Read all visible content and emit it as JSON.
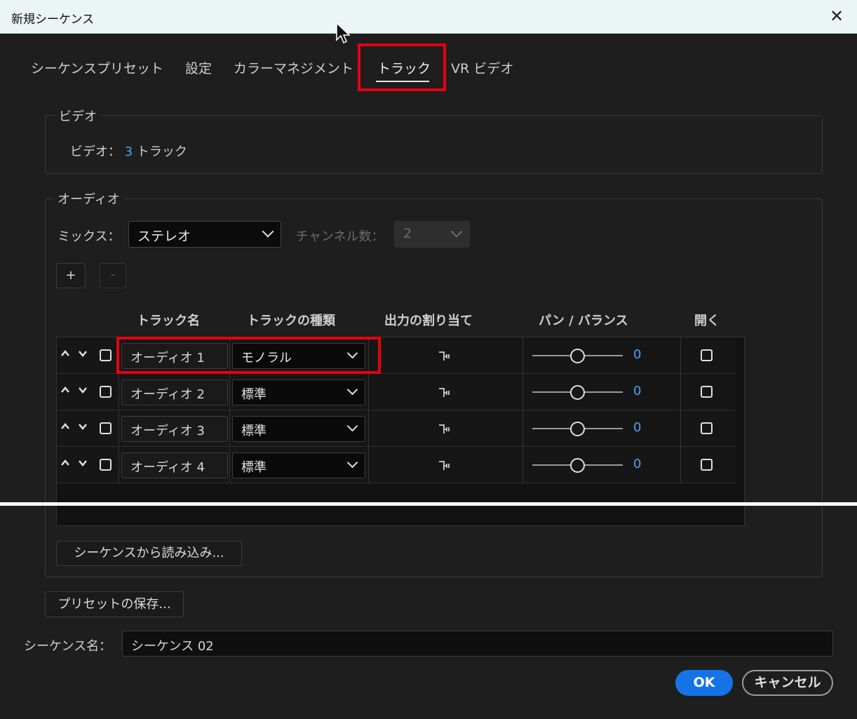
{
  "window": {
    "title": "新規シーケンス"
  },
  "tabs": [
    {
      "label": "シーケンスプリセット"
    },
    {
      "label": "設定"
    },
    {
      "label": "カラーマネジメント"
    },
    {
      "label": "トラック"
    },
    {
      "label": "VR ビデオ"
    }
  ],
  "video": {
    "legend": "ビデオ",
    "label": "ビデオ：",
    "count": "3",
    "unit": "トラック"
  },
  "audio": {
    "legend": "オーディオ",
    "mix_label": "ミックス：",
    "mix_value": "ステレオ",
    "channels_label": "チャンネル数：",
    "channels_value": "2",
    "add_label": "+",
    "remove_label": "-",
    "columns": {
      "name": "トラック名",
      "type": "トラックの種類",
      "output": "出力の割り当て",
      "pan": "パン / バランス",
      "open": "開く"
    },
    "tracks": [
      {
        "name": "オーディオ 1",
        "type": "モノラル",
        "pan": "0"
      },
      {
        "name": "オーディオ 2",
        "type": "標準",
        "pan": "0"
      },
      {
        "name": "オーディオ 3",
        "type": "標準",
        "pan": "0"
      },
      {
        "name": "オーディオ 4",
        "type": "標準",
        "pan": "0"
      }
    ],
    "import_button": "シーケンスから読み込み..."
  },
  "save_preset_button": "プリセットの保存...",
  "sequence_name": {
    "label": "シーケンス名：",
    "value": "シーケンス 02"
  },
  "ok_button": "OK",
  "cancel_button": "キャンセル",
  "colors": {
    "accent": "#4ea2f0",
    "primary_button": "#1473e6",
    "highlight": "#e60012"
  },
  "icons": [
    "close-icon",
    "cursor-icon",
    "chevron-down-icon",
    "move-up-icon",
    "move-down-icon",
    "checkbox-icon",
    "output-routing-icon",
    "pan-knob-icon"
  ]
}
